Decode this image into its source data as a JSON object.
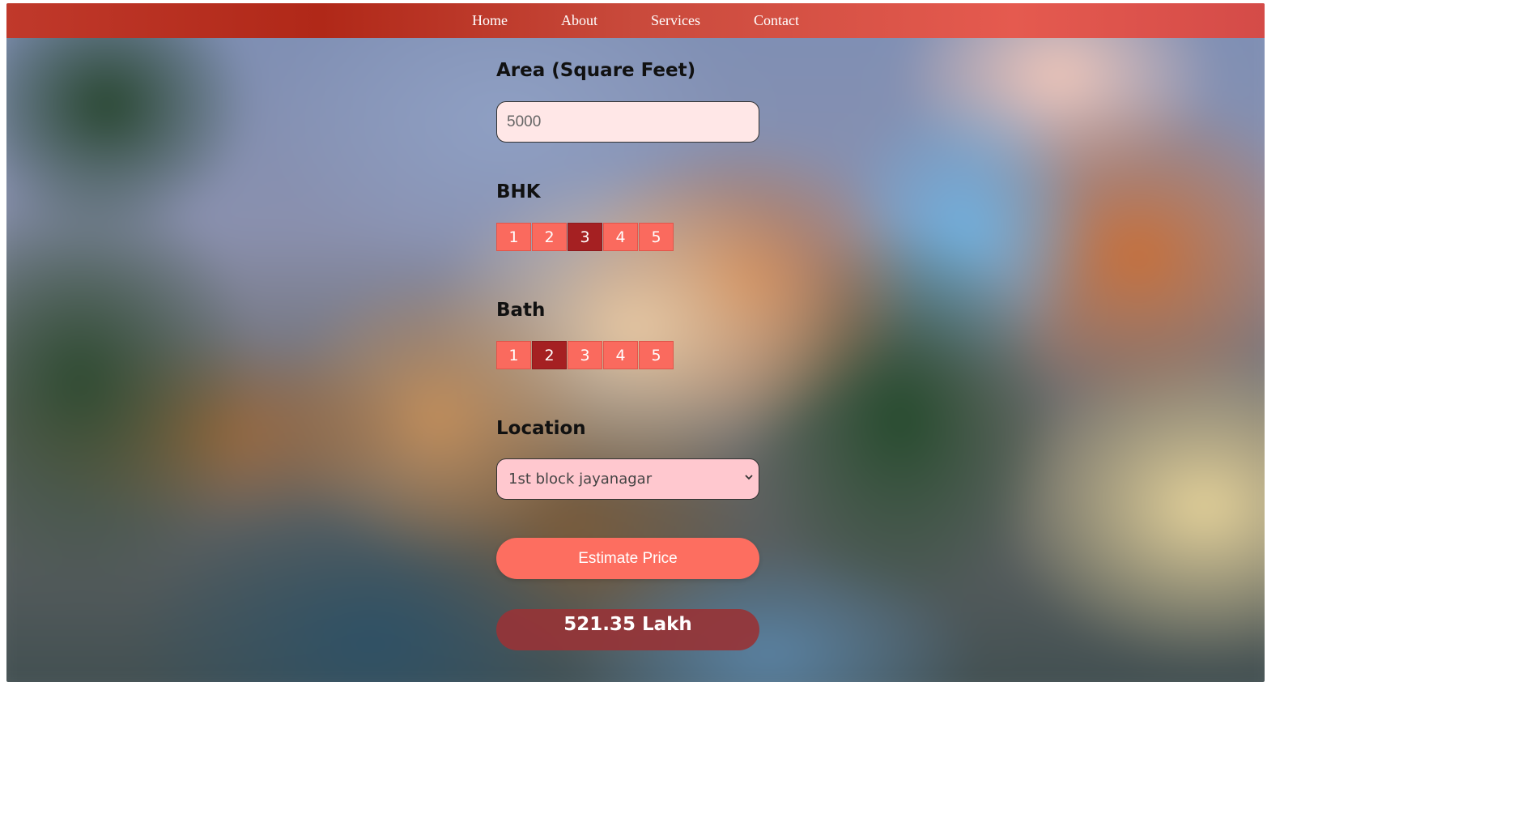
{
  "nav": {
    "items": [
      {
        "label": "Home"
      },
      {
        "label": "About"
      },
      {
        "label": "Services"
      },
      {
        "label": "Contact"
      }
    ]
  },
  "form": {
    "area": {
      "label": "Area (Square Feet)",
      "value": "5000"
    },
    "bhk": {
      "label": "BHK",
      "options": [
        "1",
        "2",
        "3",
        "4",
        "5"
      ],
      "selected": "3"
    },
    "bath": {
      "label": "Bath",
      "options": [
        "1",
        "2",
        "3",
        "4",
        "5"
      ],
      "selected": "2"
    },
    "location": {
      "label": "Location",
      "selected": "1st block jayanagar"
    },
    "estimate_label": "Estimate Price",
    "result": "521.35 Lakh"
  },
  "colors": {
    "nav_bar": "#c0392b",
    "segment": "#fa6a5e",
    "segment_selected": "#a52022",
    "button": "#fd6e60",
    "result_box": "#963437"
  }
}
